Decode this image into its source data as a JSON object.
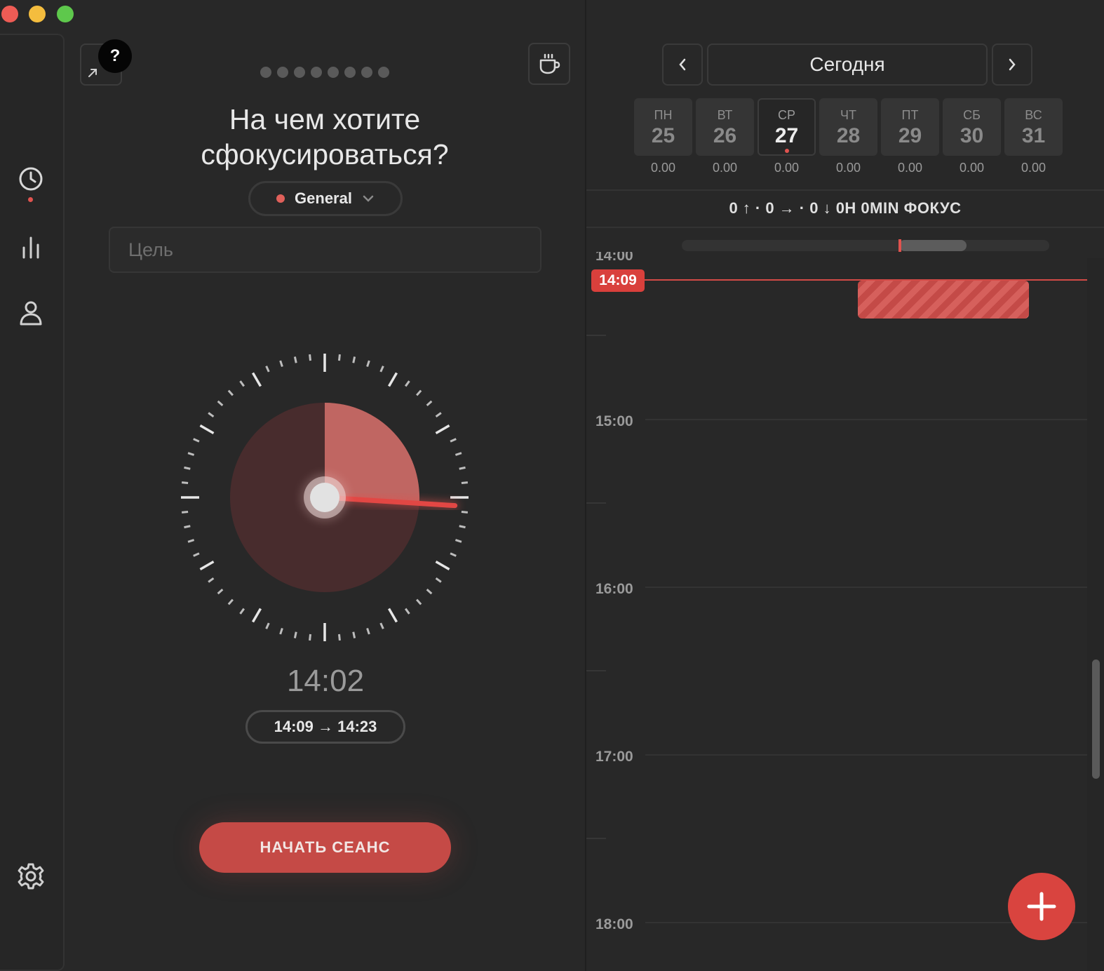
{
  "window": {
    "controls": [
      "close",
      "minimize",
      "maximize"
    ],
    "colors": {
      "close": "#ee5c55",
      "minimize": "#f4bd3e",
      "maximize": "#5ec84c"
    }
  },
  "sidebar": {
    "items": [
      {
        "icon": "clock-icon",
        "active": true
      },
      {
        "icon": "bar-chart-icon",
        "active": false
      },
      {
        "icon": "user-icon",
        "active": false
      }
    ],
    "bottom_icon": "gear-icon"
  },
  "focus": {
    "help_label": "?",
    "question": "На чем хотите сфокусироваться?",
    "category": {
      "label": "General",
      "color": "#e0605a"
    },
    "goal_placeholder": "Цель",
    "goal_value": "",
    "step_dots": 8,
    "dial_progress": 0.26,
    "current_time": "14:02",
    "range": "14:09 → 14:23",
    "start_label": "НАЧАТЬ СЕАНС",
    "accent": "#c54a46"
  },
  "calendar": {
    "today_label": "Сегодня",
    "days": [
      {
        "weekday": "ПН",
        "day": "25",
        "value": "0.00",
        "today": false
      },
      {
        "weekday": "ВТ",
        "day": "26",
        "value": "0.00",
        "today": false
      },
      {
        "weekday": "СР",
        "day": "27",
        "value": "0.00",
        "today": true
      },
      {
        "weekday": "ЧТ",
        "day": "28",
        "value": "0.00",
        "today": false
      },
      {
        "weekday": "ПТ",
        "day": "29",
        "value": "0.00",
        "today": false
      },
      {
        "weekday": "СБ",
        "day": "30",
        "value": "0.00",
        "today": false
      },
      {
        "weekday": "ВС",
        "day": "31",
        "value": "0.00",
        "today": false
      }
    ],
    "stats": "0 ↑ · 0 → · 0 ↓  0H 0MIN ФОКУС",
    "now_time": "14:09",
    "hours": [
      "14:00",
      "15:00",
      "16:00",
      "17:00",
      "18:00"
    ],
    "now_color": "#d9403c"
  }
}
